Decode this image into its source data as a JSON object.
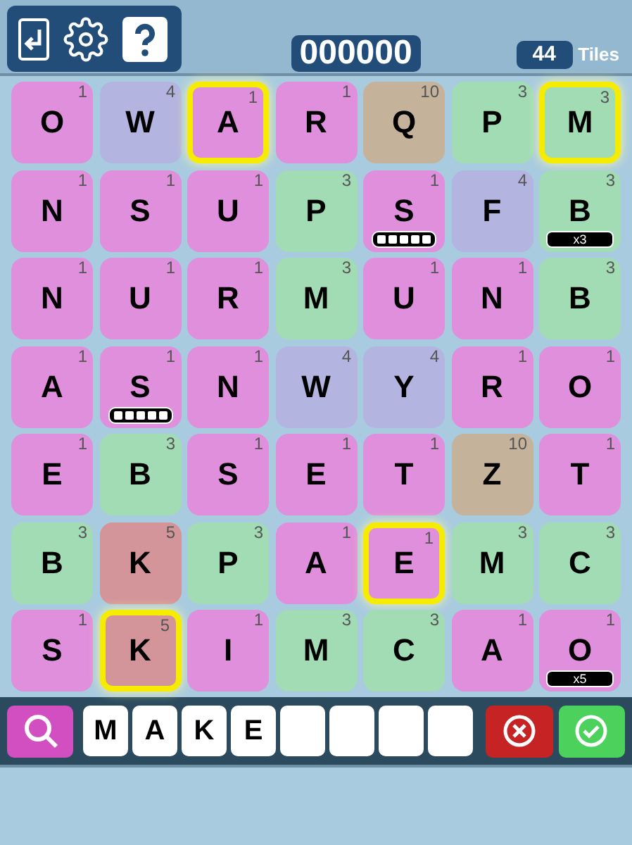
{
  "header": {
    "score": "000000",
    "tiles_count": "44",
    "tiles_label": "Tiles"
  },
  "board": [
    [
      {
        "letter": "O",
        "points": "1",
        "color": "#df8fdb",
        "selected": false
      },
      {
        "letter": "W",
        "points": "4",
        "color": "#b3b5e0",
        "selected": false
      },
      {
        "letter": "A",
        "points": "1",
        "color": "#df8fdb",
        "selected": true
      },
      {
        "letter": "R",
        "points": "1",
        "color": "#df8fdb",
        "selected": false
      },
      {
        "letter": "Q",
        "points": "10",
        "color": "#c5b29b",
        "selected": false
      },
      {
        "letter": "P",
        "points": "3",
        "color": "#a2dcb5",
        "selected": false
      },
      {
        "letter": "M",
        "points": "3",
        "color": "#a2dcb5",
        "selected": true
      }
    ],
    [
      {
        "letter": "N",
        "points": "1",
        "color": "#df8fdb",
        "selected": false
      },
      {
        "letter": "S",
        "points": "1",
        "color": "#df8fdb",
        "selected": false
      },
      {
        "letter": "U",
        "points": "1",
        "color": "#df8fdb",
        "selected": false
      },
      {
        "letter": "P",
        "points": "3",
        "color": "#a2dcb5",
        "selected": false
      },
      {
        "letter": "S",
        "points": "1",
        "color": "#df8fdb",
        "selected": false,
        "badge": {
          "kind": "dots"
        }
      },
      {
        "letter": "F",
        "points": "4",
        "color": "#b3b5e0",
        "selected": false
      },
      {
        "letter": "B",
        "points": "3",
        "color": "#a2dcb5",
        "selected": false,
        "badge": {
          "kind": "multiplier",
          "text": "x3"
        }
      }
    ],
    [
      {
        "letter": "N",
        "points": "1",
        "color": "#df8fdb",
        "selected": false
      },
      {
        "letter": "U",
        "points": "1",
        "color": "#df8fdb",
        "selected": false
      },
      {
        "letter": "R",
        "points": "1",
        "color": "#df8fdb",
        "selected": false
      },
      {
        "letter": "M",
        "points": "3",
        "color": "#a2dcb5",
        "selected": false
      },
      {
        "letter": "U",
        "points": "1",
        "color": "#df8fdb",
        "selected": false
      },
      {
        "letter": "N",
        "points": "1",
        "color": "#df8fdb",
        "selected": false
      },
      {
        "letter": "B",
        "points": "3",
        "color": "#a2dcb5",
        "selected": false
      }
    ],
    [
      {
        "letter": "A",
        "points": "1",
        "color": "#df8fdb",
        "selected": false
      },
      {
        "letter": "S",
        "points": "1",
        "color": "#df8fdb",
        "selected": false,
        "badge": {
          "kind": "dots"
        }
      },
      {
        "letter": "N",
        "points": "1",
        "color": "#df8fdb",
        "selected": false
      },
      {
        "letter": "W",
        "points": "4",
        "color": "#b3b5e0",
        "selected": false
      },
      {
        "letter": "Y",
        "points": "4",
        "color": "#b3b5e0",
        "selected": false
      },
      {
        "letter": "R",
        "points": "1",
        "color": "#df8fdb",
        "selected": false
      },
      {
        "letter": "O",
        "points": "1",
        "color": "#df8fdb",
        "selected": false
      }
    ],
    [
      {
        "letter": "E",
        "points": "1",
        "color": "#df8fdb",
        "selected": false
      },
      {
        "letter": "B",
        "points": "3",
        "color": "#a2dcb5",
        "selected": false
      },
      {
        "letter": "S",
        "points": "1",
        "color": "#df8fdb",
        "selected": false
      },
      {
        "letter": "E",
        "points": "1",
        "color": "#df8fdb",
        "selected": false
      },
      {
        "letter": "T",
        "points": "1",
        "color": "#df8fdb",
        "selected": false
      },
      {
        "letter": "Z",
        "points": "10",
        "color": "#c5b29b",
        "selected": false
      },
      {
        "letter": "T",
        "points": "1",
        "color": "#df8fdb",
        "selected": false
      }
    ],
    [
      {
        "letter": "B",
        "points": "3",
        "color": "#a2dcb5",
        "selected": false
      },
      {
        "letter": "K",
        "points": "5",
        "color": "#d4959a",
        "selected": false
      },
      {
        "letter": "P",
        "points": "3",
        "color": "#a2dcb5",
        "selected": false
      },
      {
        "letter": "A",
        "points": "1",
        "color": "#df8fdb",
        "selected": false
      },
      {
        "letter": "E",
        "points": "1",
        "color": "#df8fdb",
        "selected": true
      },
      {
        "letter": "M",
        "points": "3",
        "color": "#a2dcb5",
        "selected": false
      },
      {
        "letter": "C",
        "points": "3",
        "color": "#a2dcb5",
        "selected": false
      }
    ],
    [
      {
        "letter": "S",
        "points": "1",
        "color": "#df8fdb",
        "selected": false
      },
      {
        "letter": "K",
        "points": "5",
        "color": "#d4959a",
        "selected": true
      },
      {
        "letter": "I",
        "points": "1",
        "color": "#df8fdb",
        "selected": false
      },
      {
        "letter": "M",
        "points": "3",
        "color": "#a2dcb5",
        "selected": false
      },
      {
        "letter": "C",
        "points": "3",
        "color": "#a2dcb5",
        "selected": false
      },
      {
        "letter": "A",
        "points": "1",
        "color": "#df8fdb",
        "selected": false
      },
      {
        "letter": "O",
        "points": "1",
        "color": "#df8fdb",
        "selected": false,
        "badge": {
          "kind": "multiplier",
          "text": "x5"
        }
      }
    ]
  ],
  "word_slots": [
    {
      "kind": "filled",
      "letter": "M"
    },
    {
      "kind": "filled",
      "letter": "A"
    },
    {
      "kind": "filled",
      "letter": "K"
    },
    {
      "kind": "filled",
      "letter": "E"
    },
    {
      "kind": "empty"
    },
    {
      "kind": "empty"
    },
    {
      "kind": "empty"
    },
    {
      "kind": "empty"
    }
  ]
}
